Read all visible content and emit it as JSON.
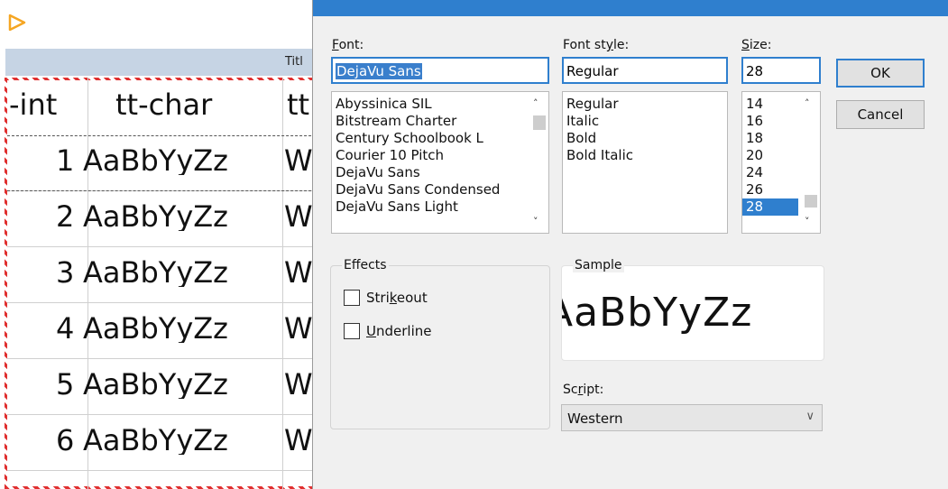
{
  "background": {
    "title_fragment": "Titl",
    "header_cells": [
      "-int",
      "tt-char",
      "tt"
    ],
    "rows": [
      {
        "num": "1",
        "text": "AaBbYyZz",
        "tail": "W"
      },
      {
        "num": "2",
        "text": "AaBbYyZz",
        "tail": "W"
      },
      {
        "num": "3",
        "text": "AaBbYyZz",
        "tail": "W"
      },
      {
        "num": "4",
        "text": "AaBbYyZz",
        "tail": "W"
      },
      {
        "num": "5",
        "text": "AaBbYyZz",
        "tail": "W"
      },
      {
        "num": "6",
        "text": "AaBbYyZz",
        "tail": "W"
      }
    ],
    "accent_color": "#f5a623"
  },
  "dialog": {
    "font": {
      "label_prefix": "",
      "label_access": "F",
      "label_rest": "ont:",
      "value": "DejaVu Sans",
      "items": [
        "Abyssinica SIL",
        "Bitstream Charter",
        "Century Schoolbook L",
        "Courier 10 Pitch",
        "DejaVu Sans",
        "DejaVu Sans Condensed",
        "DejaVu Sans Light"
      ]
    },
    "style": {
      "label_prefix": "Font st",
      "label_access": "y",
      "label_rest": "le:",
      "value": "Regular",
      "items": [
        "Regular",
        "Italic",
        "Bold",
        "Bold Italic"
      ]
    },
    "size": {
      "label_prefix": "",
      "label_access": "S",
      "label_rest": "ize:",
      "value": "28",
      "items": [
        "14",
        "16",
        "18",
        "20",
        "24",
        "26",
        "28"
      ],
      "selected": "28"
    },
    "buttons": {
      "ok": "OK",
      "cancel": "Cancel"
    },
    "effects": {
      "title": "Effects",
      "strikeout_prefix": "Stri",
      "strikeout_access": "k",
      "strikeout_rest": "eout",
      "underline_prefix": "",
      "underline_access": "U",
      "underline_rest": "nderline"
    },
    "sample": {
      "title": "Sample",
      "text": "AaBbYyZz"
    },
    "script": {
      "label_prefix": "Sc",
      "label_access": "r",
      "label_rest": "ipt:",
      "value": "Western"
    },
    "title_bar_color": "#2f7fce"
  }
}
